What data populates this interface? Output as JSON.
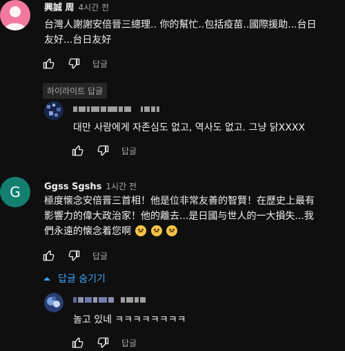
{
  "comments": [
    {
      "author": "興誠 周",
      "time": "4시간 전",
      "text_lines": [
        "台灣人謝謝安倍晉三總理.. 你的幫忙..包括疫苗..國際援助...台日",
        "友好...台日友好"
      ],
      "reply_label": "답글",
      "highlight_label": "하이라이트 답글",
      "avatar_color": "#f27a9c",
      "reply": {
        "text": "대만 사람에게 자존심도 없고, 역사도 없고. 그냥 닭XXXX",
        "reply_label": "답글"
      }
    },
    {
      "author": "Ggss Sgshs",
      "time": "1시간 전",
      "avatar_letter": "G",
      "avatar_color": "#13806f",
      "text_lines": [
        "極度懐念安倍晋三首相！他是位非常友善的智賢！在歴史上最有",
        "影響力的偉大政治家！他的離去...是日國与世人的一大損失...我",
        "們永遠的懐念着您啊"
      ],
      "emoji": [
        "sad-emoji",
        "sad-emoji",
        "sad-emoji"
      ],
      "reply_label": "답글",
      "hide_replies_label": "답글 숨기기",
      "reply": {
        "text": "놀고 있네 ㅋㅋㅋㅋㅋㅋㅋㅋ",
        "reply_label": "답글"
      }
    }
  ],
  "colors": {
    "background": "#0f0f0f",
    "link": "#3ea6ff",
    "muted": "#aaaaaa"
  }
}
